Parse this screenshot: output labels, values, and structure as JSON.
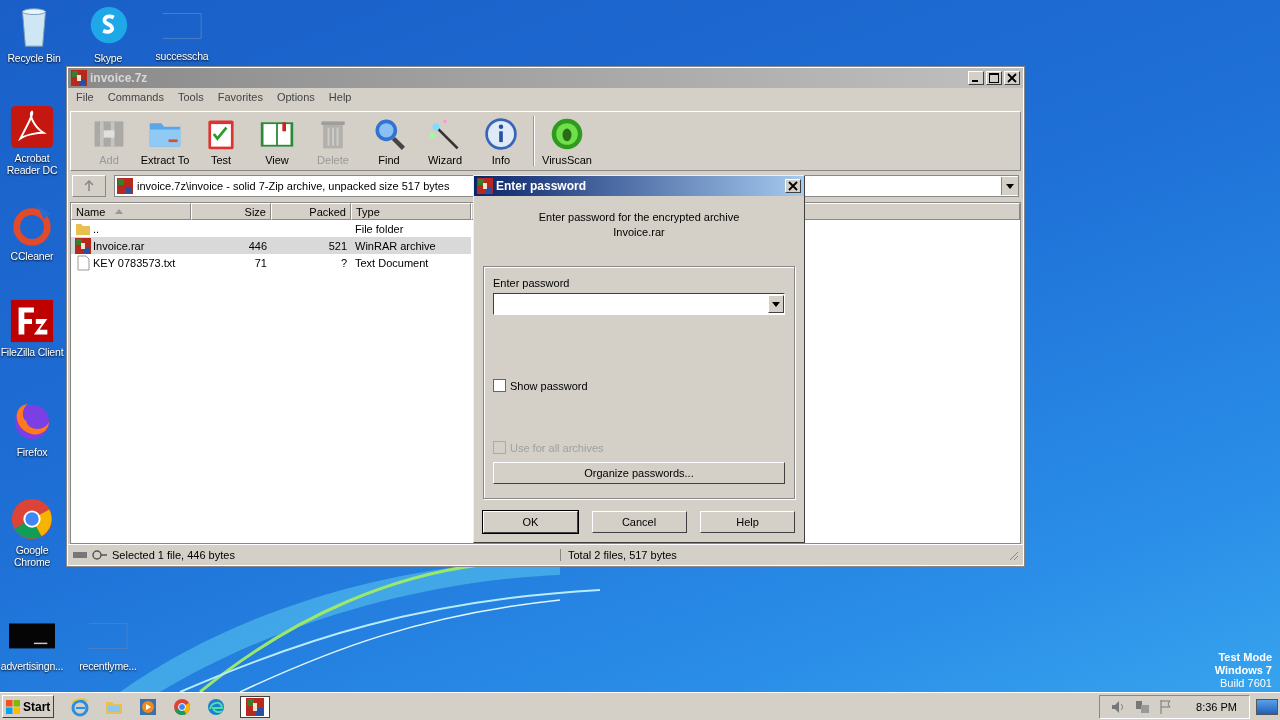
{
  "desktop": {
    "icons": [
      {
        "label": "Recycle Bin",
        "kind": "recycle"
      },
      {
        "label": "Skype",
        "kind": "skype"
      },
      {
        "label": "successcha",
        "kind": "blank"
      },
      {
        "label": "Acrobat Reader DC",
        "kind": "acrobat"
      },
      {
        "label": "CCleaner",
        "kind": "ccleaner"
      },
      {
        "label": "FileZilla Client",
        "kind": "filezilla"
      },
      {
        "label": "Firefox",
        "kind": "firefox"
      },
      {
        "label": "Google Chrome",
        "kind": "chrome"
      },
      {
        "label": "advertisingn...",
        "kind": "dark"
      },
      {
        "label": "recentlyme...",
        "kind": "blank"
      }
    ],
    "system_text": [
      "Test Mode",
      "Windows 7",
      "Build 7601"
    ]
  },
  "window": {
    "title": "invoice.7z",
    "menu": [
      "File",
      "Commands",
      "Tools",
      "Favorites",
      "Options",
      "Help"
    ],
    "toolbar": [
      {
        "label": "Add",
        "kind": "add",
        "disabled": true
      },
      {
        "label": "Extract To",
        "kind": "extract",
        "disabled": false
      },
      {
        "label": "Test",
        "kind": "test",
        "disabled": false
      },
      {
        "label": "View",
        "kind": "view",
        "disabled": false
      },
      {
        "label": "Delete",
        "kind": "delete",
        "disabled": true
      },
      {
        "label": "Find",
        "kind": "find",
        "disabled": false
      },
      {
        "label": "Wizard",
        "kind": "wizard",
        "disabled": false
      },
      {
        "label": "Info",
        "kind": "info",
        "disabled": false
      },
      {
        "label": "VirusScan",
        "kind": "virus",
        "disabled": false
      }
    ],
    "address": "invoice.7z\\invoice - solid 7-Zip archive, unpacked size 517 bytes",
    "columns": [
      "Name",
      "Size",
      "Packed",
      "Type"
    ],
    "rows": [
      {
        "name": "..",
        "size": "",
        "packed": "",
        "type": "File folder",
        "kind": "folder",
        "selected": false
      },
      {
        "name": "Invoice.rar",
        "size": "446",
        "packed": "521",
        "type": "WinRAR archive",
        "kind": "archive",
        "selected": true
      },
      {
        "name": "KEY 0783573.txt",
        "size": "71",
        "packed": "?",
        "type": "Text Document",
        "kind": "text",
        "selected": false
      }
    ],
    "status_left": "Selected 1 file, 446 bytes",
    "status_right": "Total 2 files, 517 bytes"
  },
  "dialog": {
    "title": "Enter password",
    "message": [
      "Enter password for the encrypted archive",
      "Invoice.rar"
    ],
    "field_label": "Enter password",
    "show_password": {
      "label": "Show password",
      "checked": false,
      "disabled": false
    },
    "use_for_all": {
      "label": "Use for all archives",
      "checked": false,
      "disabled": true
    },
    "organize": "Organize passwords...",
    "buttons": [
      {
        "label": "OK",
        "default": true
      },
      {
        "label": "Cancel",
        "default": false
      },
      {
        "label": "Help",
        "default": false
      }
    ]
  },
  "taskbar": {
    "start": "Start",
    "apps": [
      {
        "kind": "ie",
        "active": false
      },
      {
        "kind": "explorer",
        "active": false
      },
      {
        "kind": "media",
        "active": false
      },
      {
        "kind": "chrome",
        "active": false
      },
      {
        "kind": "edge",
        "active": false
      },
      {
        "kind": "winrar",
        "active": true
      }
    ],
    "time": "8:36 PM"
  }
}
